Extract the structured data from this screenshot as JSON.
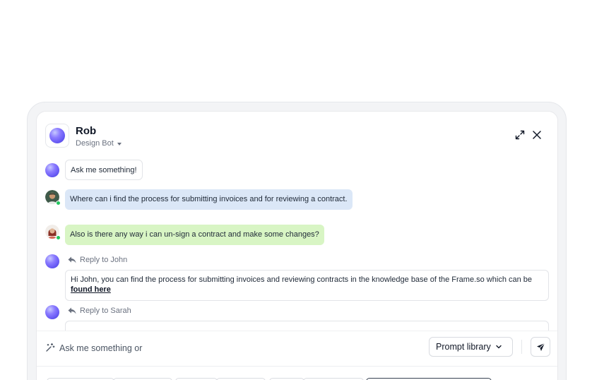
{
  "bot": {
    "name": "Rob",
    "role": "Design Bot"
  },
  "messages": {
    "bot_greeting": "Ask me something!",
    "john_question": "Where can i find the process for submitting invoices and for reviewing a contract.",
    "sarah_question": "Also is there any way i can un-sign a contract and make some changes?",
    "reply_john_tag": "Reply to John",
    "reply_john_text": "Hi John, you can find the process for submitting invoices and reviewing contracts in the knowledge base of the Frame.so which can be ",
    "reply_john_link": "found here",
    "reply_sarah_tag": "Reply to Sarah"
  },
  "composer": {
    "placeholder": "Ask me something or",
    "prompt_library": "Prompt library"
  },
  "colors": {
    "blue_bubble": "#dbe7f7",
    "green_bubble": "#d8f5c4",
    "online": "#22c55e"
  },
  "icons": [
    "expand-icon",
    "close-icon",
    "reply-icon",
    "magic-wand-icon",
    "chevron-down-icon",
    "send-icon"
  ]
}
